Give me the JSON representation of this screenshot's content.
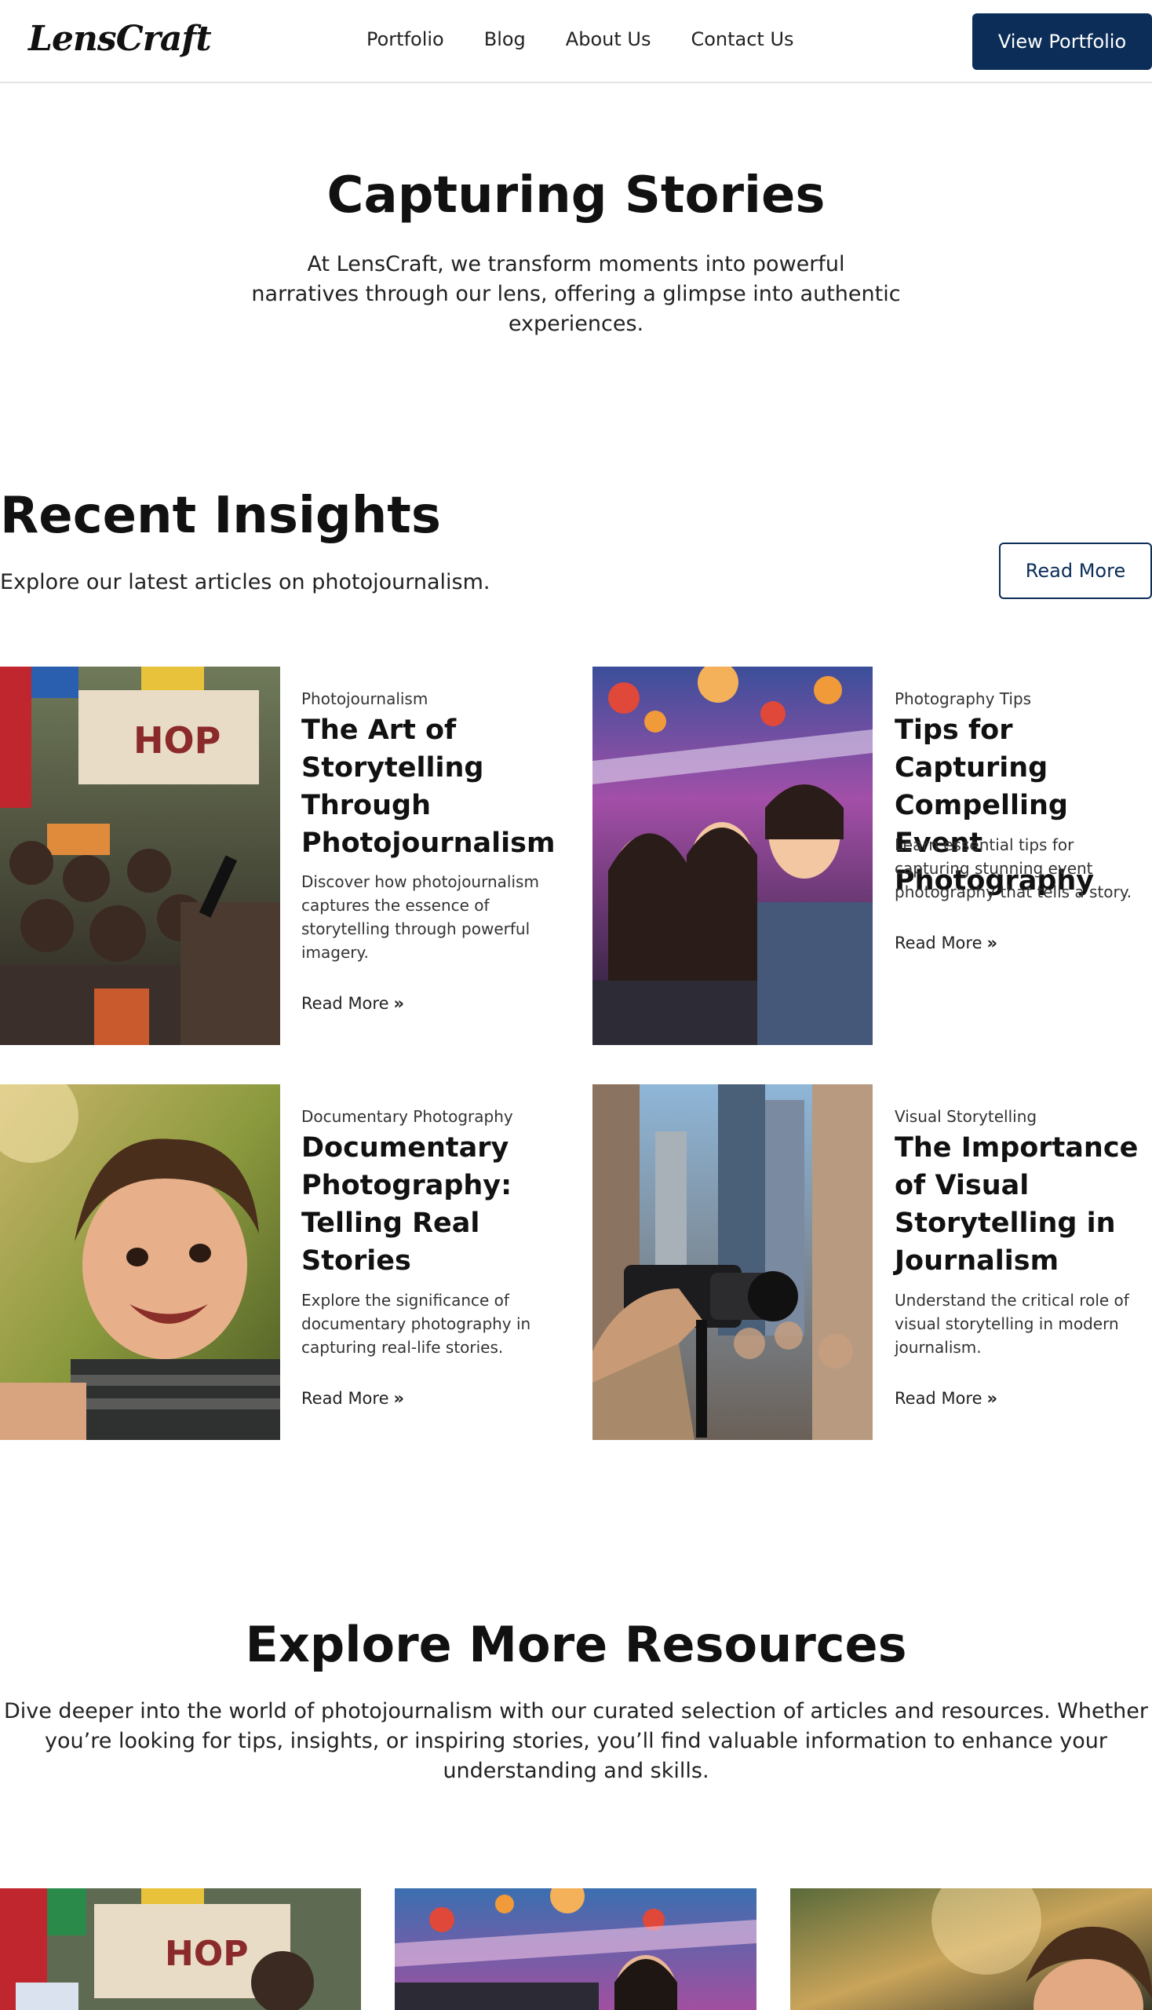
{
  "header": {
    "logo": "LensCraft",
    "nav": [
      "Portfolio",
      "Blog",
      "About Us",
      "Contact Us"
    ],
    "cta": "View Portfolio"
  },
  "hero": {
    "title": "Capturing Stories",
    "subtitle": "At LensCraft, we transform moments into powerful narratives through our lens, offering a glimpse into authentic experiences."
  },
  "recent": {
    "title": "Recent Insights",
    "subtitle": "Explore our latest articles on photojournalism.",
    "button": "Read More",
    "cards": [
      {
        "category": "Photojournalism",
        "title": "The Art of Storytelling Through Photojournalism",
        "desc": "Discover how photojournalism captures the essence of storytelling through powerful imagery.",
        "link": "Read More",
        "image": "protest-crowd-photo"
      },
      {
        "category": "Photography Tips",
        "title": "Tips for Capturing Compelling Event Photography",
        "desc": "Learn essential tips for capturing stunning event photography that tells a story.",
        "link": "Read More",
        "image": "festival-crowd-photo"
      },
      {
        "category": "Documentary Photography",
        "title": "Documentary Photography: Telling Real Stories",
        "desc": "Explore the significance of documentary photography in capturing real-life stories.",
        "link": "Read More",
        "image": "smiling-child-photo"
      },
      {
        "category": "Visual Storytelling",
        "title": "The Importance of Visual Storytelling in Journalism",
        "desc": "Understand the critical role of visual storytelling in modern journalism.",
        "link": "Read More",
        "image": "camera-in-city-photo"
      }
    ]
  },
  "explore": {
    "title": "Explore More Resources",
    "subtitle": "Dive deeper into the world of photojournalism with our curated selection of articles and resources. Whether you’re looking for tips, insights, or inspiring stories, you’ll find valuable information to enhance your understanding and skills."
  },
  "colors": {
    "brand": "#0b2d57",
    "text": "#111111",
    "border": "#e3e3e3"
  }
}
